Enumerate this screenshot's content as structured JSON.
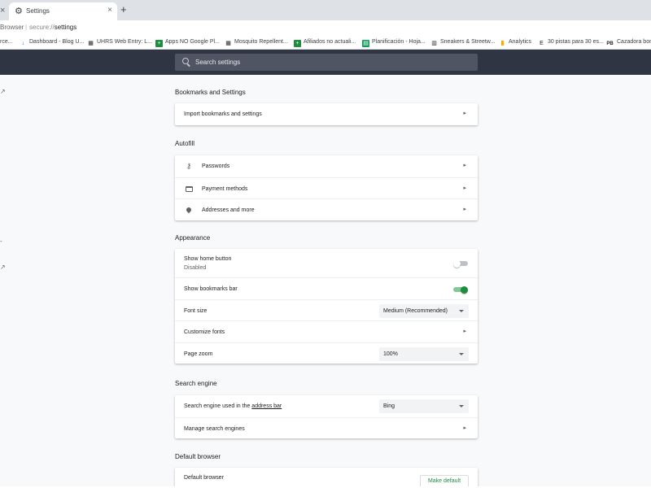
{
  "tabs": {
    "active": {
      "title": "Settings"
    },
    "close_glyph": "×",
    "new_tab_glyph": "+"
  },
  "address_bar": {
    "browser_label": "Browser",
    "separator": "|",
    "url_scheme": "secure://",
    "url_path": "settings"
  },
  "bookmarks": [
    {
      "label": "rce...",
      "icon": "generic",
      "color": "#5f6368"
    },
    {
      "label": "Dashboard - Blog U...",
      "icon": "arrow-down-icon",
      "color": "#1a73e8"
    },
    {
      "label": "UHRS Web Entry: L...",
      "icon": "uhrs-icon",
      "color": "#202124"
    },
    {
      "label": "Apps NO Google Pl...",
      "icon": "plus-icon",
      "color": "#1e8e3e"
    },
    {
      "label": "Mosquito Repellent...",
      "icon": "uhrs-icon",
      "color": "#202124"
    },
    {
      "label": "Afiliados no actuali...",
      "icon": "plus-icon",
      "color": "#1e8e3e"
    },
    {
      "label": "Planificación - Hoja...",
      "icon": "sheets-icon",
      "color": "#0f9d58"
    },
    {
      "label": "Sneakers & Streetw...",
      "icon": "store-icon",
      "color": "#202124"
    },
    {
      "label": "Analytics",
      "icon": "analytics-icon",
      "color": "#f9ab00"
    },
    {
      "label": "30 pistas para 30 es...",
      "icon": "e-icon",
      "color": "#202124"
    },
    {
      "label": "Cazadora bom",
      "icon": "pb-icon",
      "color": "#202124"
    }
  ],
  "search": {
    "placeholder": "Search settings"
  },
  "sections": {
    "bookmarks": {
      "title": "Bookmarks and Settings",
      "rows": [
        {
          "label": "Import bookmarks and settings"
        }
      ]
    },
    "autofill": {
      "title": "Autofill",
      "rows": [
        {
          "label": "Passwords",
          "icon": "key-icon"
        },
        {
          "label": "Payment methods",
          "icon": "credit-card-icon"
        },
        {
          "label": "Addresses and more",
          "icon": "location-pin-icon"
        }
      ]
    },
    "appearance": {
      "title": "Appearance",
      "home_button": {
        "label": "Show home button",
        "sub": "Disabled",
        "on": false
      },
      "bookmarks_bar": {
        "label": "Show bookmarks bar",
        "on": true
      },
      "font_size": {
        "label": "Font size",
        "value": "Medium (Recommended)"
      },
      "customize_fonts": {
        "label": "Customize fonts"
      },
      "page_zoom": {
        "label": "Page zoom",
        "value": "100%"
      }
    },
    "search_engine": {
      "title": "Search engine",
      "used_prefix": "Search engine used in the ",
      "used_link": "address bar",
      "value": "Bing",
      "manage": "Manage search engines"
    },
    "default_browser": {
      "title": "Default browser",
      "label": "Default browser",
      "button": "Make default"
    }
  },
  "colors": {
    "accent": "#1e8e3e",
    "header": "#2f3542",
    "toggle_on": "#1e8e3e",
    "toggle_on_track": "#81c995",
    "toggle_off_knob": "#ffffff",
    "toggle_off_track": "#bdc1c6"
  }
}
